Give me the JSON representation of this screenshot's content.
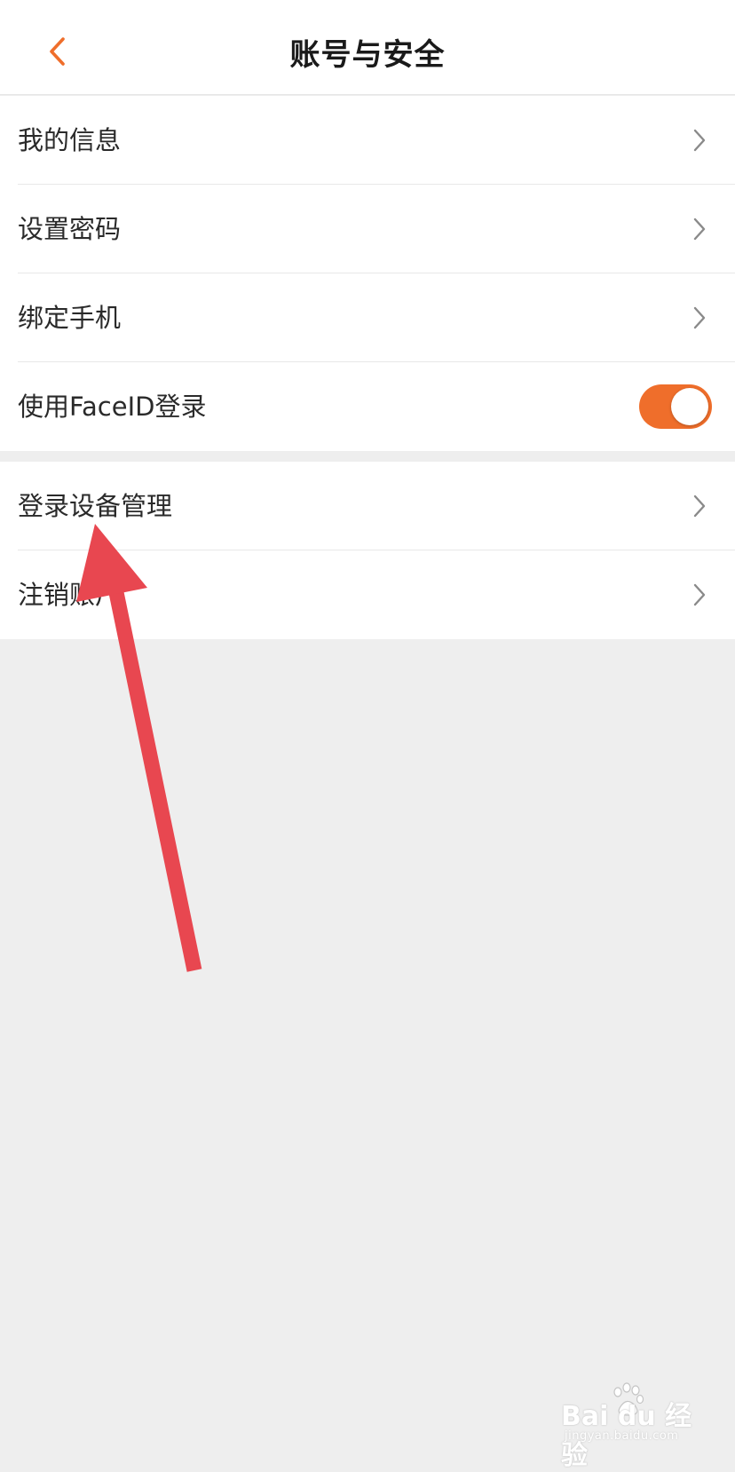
{
  "header": {
    "title": "账号与安全",
    "back_icon": "chevron-left-icon"
  },
  "settings_group_1": [
    {
      "label": "我的信息",
      "trailing": "chevron-right-icon"
    },
    {
      "label": "设置密码",
      "trailing": "chevron-right-icon"
    },
    {
      "label": "绑定手机",
      "trailing": "chevron-right-icon"
    },
    {
      "label": "使用FaceID登录",
      "trailing": "toggle",
      "toggle_on": true
    }
  ],
  "settings_group_2": [
    {
      "label": "登录设备管理",
      "trailing": "chevron-right-icon"
    },
    {
      "label": "注销账户",
      "trailing": "chevron-right-icon"
    }
  ],
  "watermark": {
    "main": "Bai du 经验",
    "sub": "jingyan.baidu.com"
  },
  "colors": {
    "accent": "#ef6e2b",
    "annotation_arrow": "#e84750",
    "page_background": "#eeeeee"
  }
}
